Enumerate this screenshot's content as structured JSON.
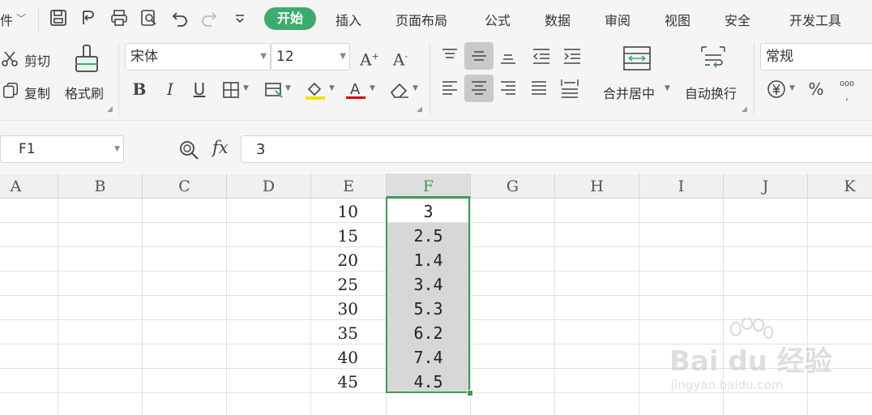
{
  "menu": {
    "file_partial": "件",
    "tabs": [
      "开始",
      "插入",
      "页面布局",
      "公式",
      "数据",
      "审阅",
      "视图",
      "安全",
      "开发工具"
    ]
  },
  "ribbon": {
    "cut_label": "剪切",
    "copy_label": "复制",
    "format_painter_label": "格式刷",
    "font_name": "宋体",
    "font_size": "12",
    "merge_center_label": "合并居中",
    "wrap_text_label": "自动换行",
    "number_format": "常规"
  },
  "formula_bar": {
    "cell_ref": "F1",
    "fx_label": "fx",
    "value": "3"
  },
  "columns": [
    "A",
    "B",
    "C",
    "D",
    "E",
    "F",
    "G",
    "H",
    "I",
    "J",
    "K"
  ],
  "rows": [
    {
      "e": "10",
      "f": "3"
    },
    {
      "e": "15",
      "f": "2.5"
    },
    {
      "e": "20",
      "f": "1.4"
    },
    {
      "e": "25",
      "f": "3.4"
    },
    {
      "e": "30",
      "f": "5.3"
    },
    {
      "e": "35",
      "f": "6.2"
    },
    {
      "e": "40",
      "f": "7.4"
    },
    {
      "e": "45",
      "f": "4.5"
    }
  ],
  "watermark": {
    "brand": "Bai du 经验",
    "url": "jingyan.baidu.com"
  },
  "colors": {
    "accent": "#3dab6e",
    "selection_border": "#3d9b55",
    "selection_fill": "#d7d7d7"
  }
}
